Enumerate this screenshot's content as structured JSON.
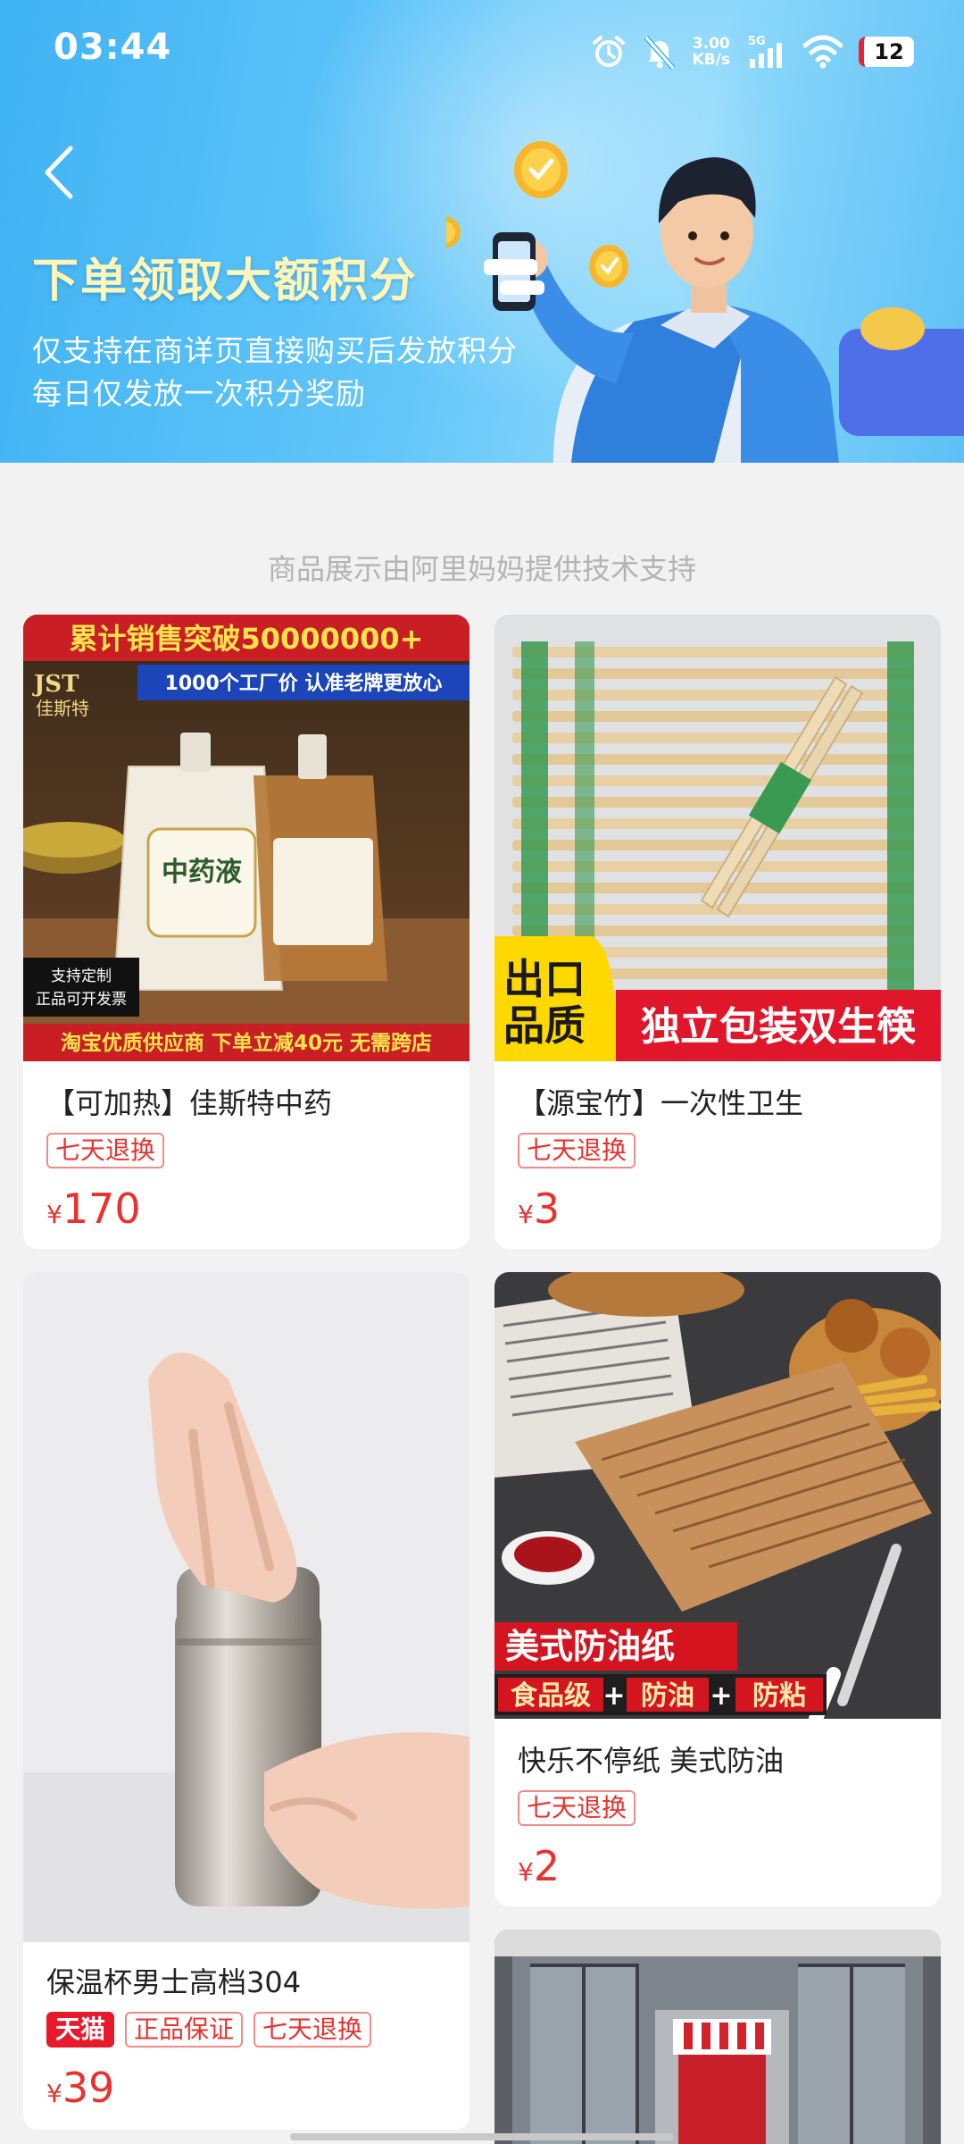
{
  "status_bar": {
    "time": "03:44",
    "net_speed_value": "3.00",
    "net_speed_unit": "KB/s",
    "network": "5G",
    "battery": "12"
  },
  "banner": {
    "title": "下单领取大额积分",
    "line1": "仅支持在商详页直接购买后发放积分",
    "line2": "每日仅发放一次积分奖励"
  },
  "tagline": "商品展示由阿里妈妈提供技术支持",
  "products": [
    {
      "title": "【可加热】佳斯特中药",
      "tags": [
        "七天退换"
      ],
      "currency": "¥",
      "price": "170",
      "image_text": {
        "top_banner": "累计销售突破50000000+",
        "brand": "JST",
        "brand_cn": "佳斯特",
        "slogan": "1000个工厂价 认准老牌更放心",
        "bag_label": "中药液",
        "custom": "支持定制",
        "invoice": "正品可开发票",
        "bottom_banner": "淘宝优质供应商 下单立减40元 无需跨店"
      }
    },
    {
      "title": "【源宝竹】一次性卫生",
      "tags": [
        "七天退换"
      ],
      "currency": "¥",
      "price": "3",
      "image_text": {
        "badge_line1": "出口",
        "badge_line2": "品质",
        "bottom_banner": "独立包装双生筷"
      }
    },
    {
      "title": "保温杯男士高档304",
      "tags": [
        "天猫",
        "正品保证",
        "七天退换"
      ],
      "currency": "¥",
      "price": "39"
    },
    {
      "title": "快乐不停纸 美式防油",
      "tags": [
        "七天退换"
      ],
      "currency": "¥",
      "price": "2",
      "image_text": {
        "headline": "美式防油纸",
        "feature1": "食品级",
        "feature2": "防油",
        "feature3": "防粘",
        "plus": "+"
      }
    }
  ]
}
